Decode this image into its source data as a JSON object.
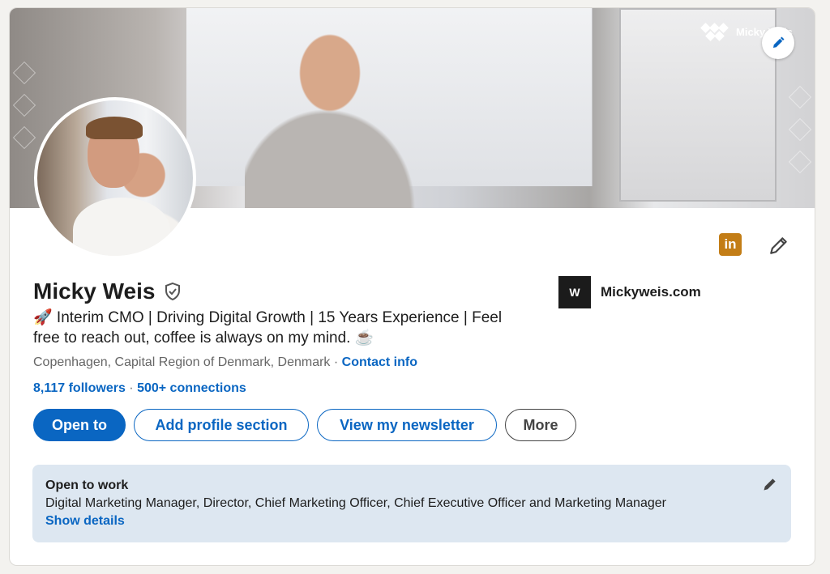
{
  "cover": {
    "brand_name": "Micky Weis",
    "edit_icon": "pencil-icon"
  },
  "profile": {
    "name": "Micky Weis",
    "verified_icon": "shield-check-icon",
    "headline": "🚀 Interim CMO | Driving Digital Growth | 15 Years Experience | Feel free to reach out, coffee is always on my mind. ☕",
    "location": "Copenhagen, Capital Region of Denmark, Denmark",
    "location_sep": " · ",
    "contact_info": "Contact info",
    "followers": "8,117 followers",
    "stats_sep": " · ",
    "connections": "500+ connections",
    "company": "Mickyweis.com",
    "company_logo_text": "W",
    "linkedin_badge": "in"
  },
  "actions": {
    "open_to": "Open to",
    "add_profile_section": "Add profile section",
    "view_newsletter": "View my newsletter",
    "more": "More"
  },
  "open_to_work": {
    "title": "Open to work",
    "roles": "Digital Marketing Manager, Director, Chief Marketing Officer, Chief Executive Officer and Marketing Manager",
    "show_details": "Show details"
  },
  "colors": {
    "accent": "#0a66c2",
    "linkedin_badge": "#c37d16",
    "open_to_work_bg": "#dde7f1"
  }
}
